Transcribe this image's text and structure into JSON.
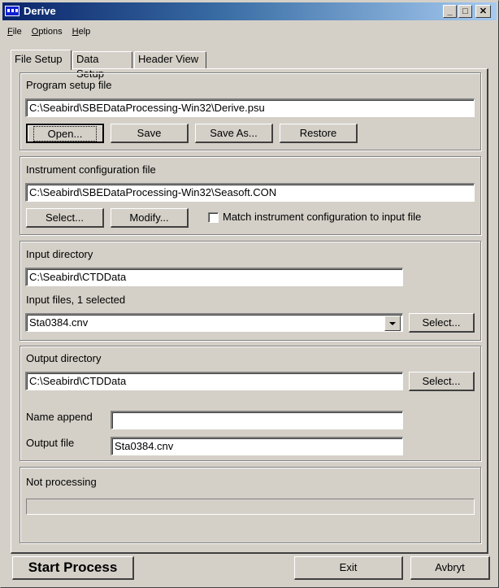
{
  "window": {
    "title": "Derive",
    "controls": {
      "minimize": "_",
      "maximize": "□",
      "close": "✕"
    }
  },
  "menu": [
    {
      "label": "File",
      "accel": "F"
    },
    {
      "label": "Options",
      "accel": "O"
    },
    {
      "label": "Help",
      "accel": "H"
    }
  ],
  "tabs": [
    {
      "label": "File Setup",
      "active": true
    },
    {
      "label": "Data Setup",
      "active": false
    },
    {
      "label": "Header View",
      "active": false
    }
  ],
  "program_setup": {
    "label": "Program setup file",
    "path": "C:\\Seabird\\SBEDataProcessing-Win32\\Derive.psu",
    "buttons": {
      "open": "Open...",
      "save": "Save",
      "save_as": "Save As...",
      "restore": "Restore"
    }
  },
  "instrument_config": {
    "label": "Instrument configuration file",
    "path": "C:\\Seabird\\SBEDataProcessing-Win32\\Seasoft.CON",
    "buttons": {
      "select": "Select...",
      "modify": "Modify..."
    },
    "match_checkbox": {
      "label": "Match instrument configuration to input file",
      "checked": false
    }
  },
  "input": {
    "dir_label": "Input directory",
    "dir": "C:\\Seabird\\CTDData",
    "files_label": "Input files, 1 selected",
    "selected_file": "Sta0384.cnv",
    "select_button": "Select..."
  },
  "output": {
    "dir_label": "Output directory",
    "dir": "C:\\Seabird\\CTDData",
    "select_button": "Select...",
    "name_append_label": "Name append",
    "name_append": "",
    "output_file_label": "Output file",
    "output_file": "Sta0384.cnv"
  },
  "status": {
    "text": "Not processing",
    "progress_percent": 0
  },
  "footer": {
    "start": "Start Process",
    "exit": "Exit",
    "cancel": "Avbryt"
  }
}
